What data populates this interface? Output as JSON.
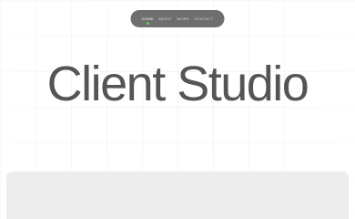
{
  "nav": {
    "items": [
      {
        "label": "HOME",
        "active": true
      },
      {
        "label": "ABOUT",
        "active": false
      },
      {
        "label": "WORK",
        "active": false
      },
      {
        "label": "CONTACT",
        "active": false
      }
    ],
    "active_indicator_color": "#5bd15b"
  },
  "hero": {
    "title": "Client Studio"
  }
}
